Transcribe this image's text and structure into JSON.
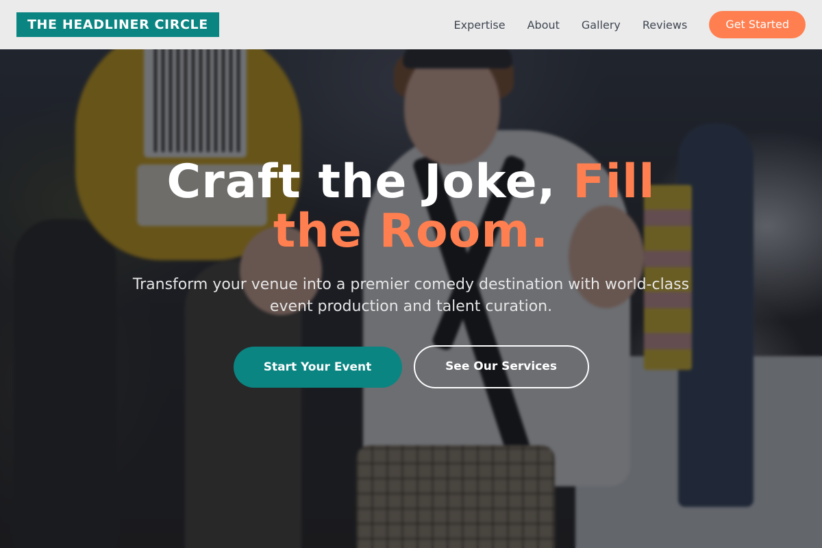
{
  "header": {
    "logo_text": "THE HEADLINER CIRCLE",
    "nav": [
      {
        "label": "Expertise"
      },
      {
        "label": "About"
      },
      {
        "label": "Gallery"
      },
      {
        "label": "Reviews"
      }
    ],
    "cta_label": "Get Started"
  },
  "hero": {
    "headline_main": "Craft the Joke, ",
    "headline_accent": "Fill the Room.",
    "subheadline": "Transform your venue into a premier comedy destination with world-class event production and talent curation.",
    "primary_button": "Start Your Event",
    "secondary_button": "See Our Services",
    "background_image": "event-host-photo"
  },
  "colors": {
    "brand_teal": "#0b8582",
    "accent_coral": "#ff7f50",
    "header_bg": "#ebebeb",
    "nav_text": "#3f4652"
  }
}
